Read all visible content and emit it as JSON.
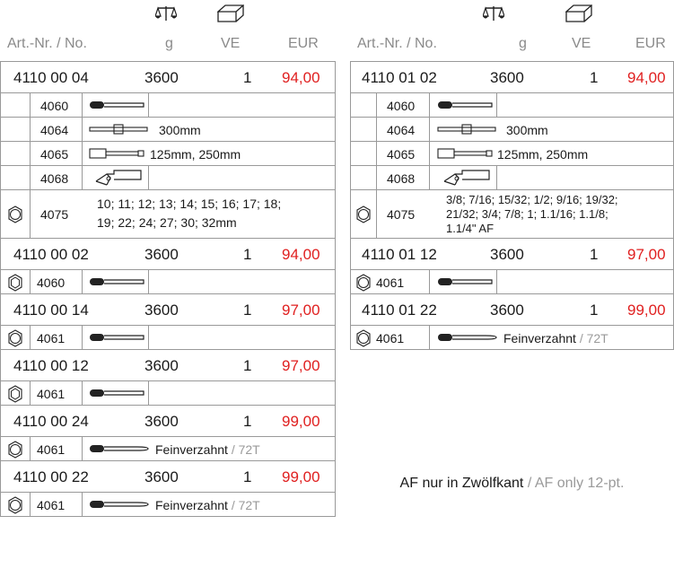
{
  "header": {
    "art_label": "Art.-Nr. / No.",
    "g_label": "g",
    "ve_label": "VE",
    "eur_label": "EUR",
    "icons": [
      "scale-icon",
      "weight-box-icon"
    ]
  },
  "left": {
    "r1": {
      "art": "4110 00 04",
      "g": "3600",
      "ve": "1",
      "eur": "94,00"
    },
    "r1_subs": [
      {
        "code": "4060",
        "tool": "ratchet"
      },
      {
        "code": "4064",
        "tool": "t-handle",
        "text": "300mm"
      },
      {
        "code": "4065",
        "tool": "extension",
        "text": "125mm, 250mm"
      },
      {
        "code": "4068",
        "tool": "adapter"
      }
    ],
    "r1_sizes_code": "4075",
    "r1_sizes_line1": "10; 11; 12; 13; 14; 15; 16; 17; 18;",
    "r1_sizes_line2": "19; 22; 24; 27; 30; 32mm",
    "r2": {
      "art": "4110 00 02",
      "g": "3600",
      "ve": "1",
      "eur": "94,00",
      "sub": "4060"
    },
    "r3": {
      "art": "4110 00 14",
      "g": "3600",
      "ve": "1",
      "eur": "97,00",
      "sub": "4061"
    },
    "r4": {
      "art": "4110 00 12",
      "g": "3600",
      "ve": "1",
      "eur": "97,00",
      "sub": "4061"
    },
    "r5": {
      "art": "4110 00 24",
      "g": "3600",
      "ve": "1",
      "eur": "99,00",
      "sub": "4061",
      "de": "Feinverzahnt",
      "sep": " / ",
      "en": "72T"
    },
    "r6": {
      "art": "4110 00 22",
      "g": "3600",
      "ve": "1",
      "eur": "99,00",
      "sub": "4061",
      "de": "Feinverzahnt",
      "sep": " / ",
      "en": "72T"
    }
  },
  "right": {
    "r1": {
      "art": "4110 01 02",
      "g": "3600",
      "ve": "1",
      "eur": "94,00"
    },
    "r1_subs": [
      {
        "code": "4060",
        "tool": "ratchet"
      },
      {
        "code": "4064",
        "tool": "t-handle",
        "text": "300mm"
      },
      {
        "code": "4065",
        "tool": "extension",
        "text": "125mm, 250mm"
      },
      {
        "code": "4068",
        "tool": "adapter"
      }
    ],
    "r1_sizes_code": "4075",
    "r1_sizes_line1": "3/8; 7/16; 15/32; 1/2; 9/16; 19/32;",
    "r1_sizes_line2": "21/32; 3/4; 7/8; 1; 1.1/16; 1.1/8;",
    "r1_sizes_line3": "1.1/4\" AF",
    "r2": {
      "art": "4110 01 12",
      "g": "3600",
      "ve": "1",
      "eur": "97,00",
      "sub": "4061"
    },
    "r3": {
      "art": "4110 01 22",
      "g": "3600",
      "ve": "1",
      "eur": "99,00",
      "sub": "4061",
      "de": "Feinverzahnt",
      "sep": " / ",
      "en": "72T"
    }
  },
  "note": {
    "de": "AF nur in Zwölfkant",
    "sep": " / ",
    "en": "AF only 12-pt."
  },
  "colors": {
    "price": "#e02020",
    "muted": "#9a9a9a",
    "line": "#999999"
  }
}
